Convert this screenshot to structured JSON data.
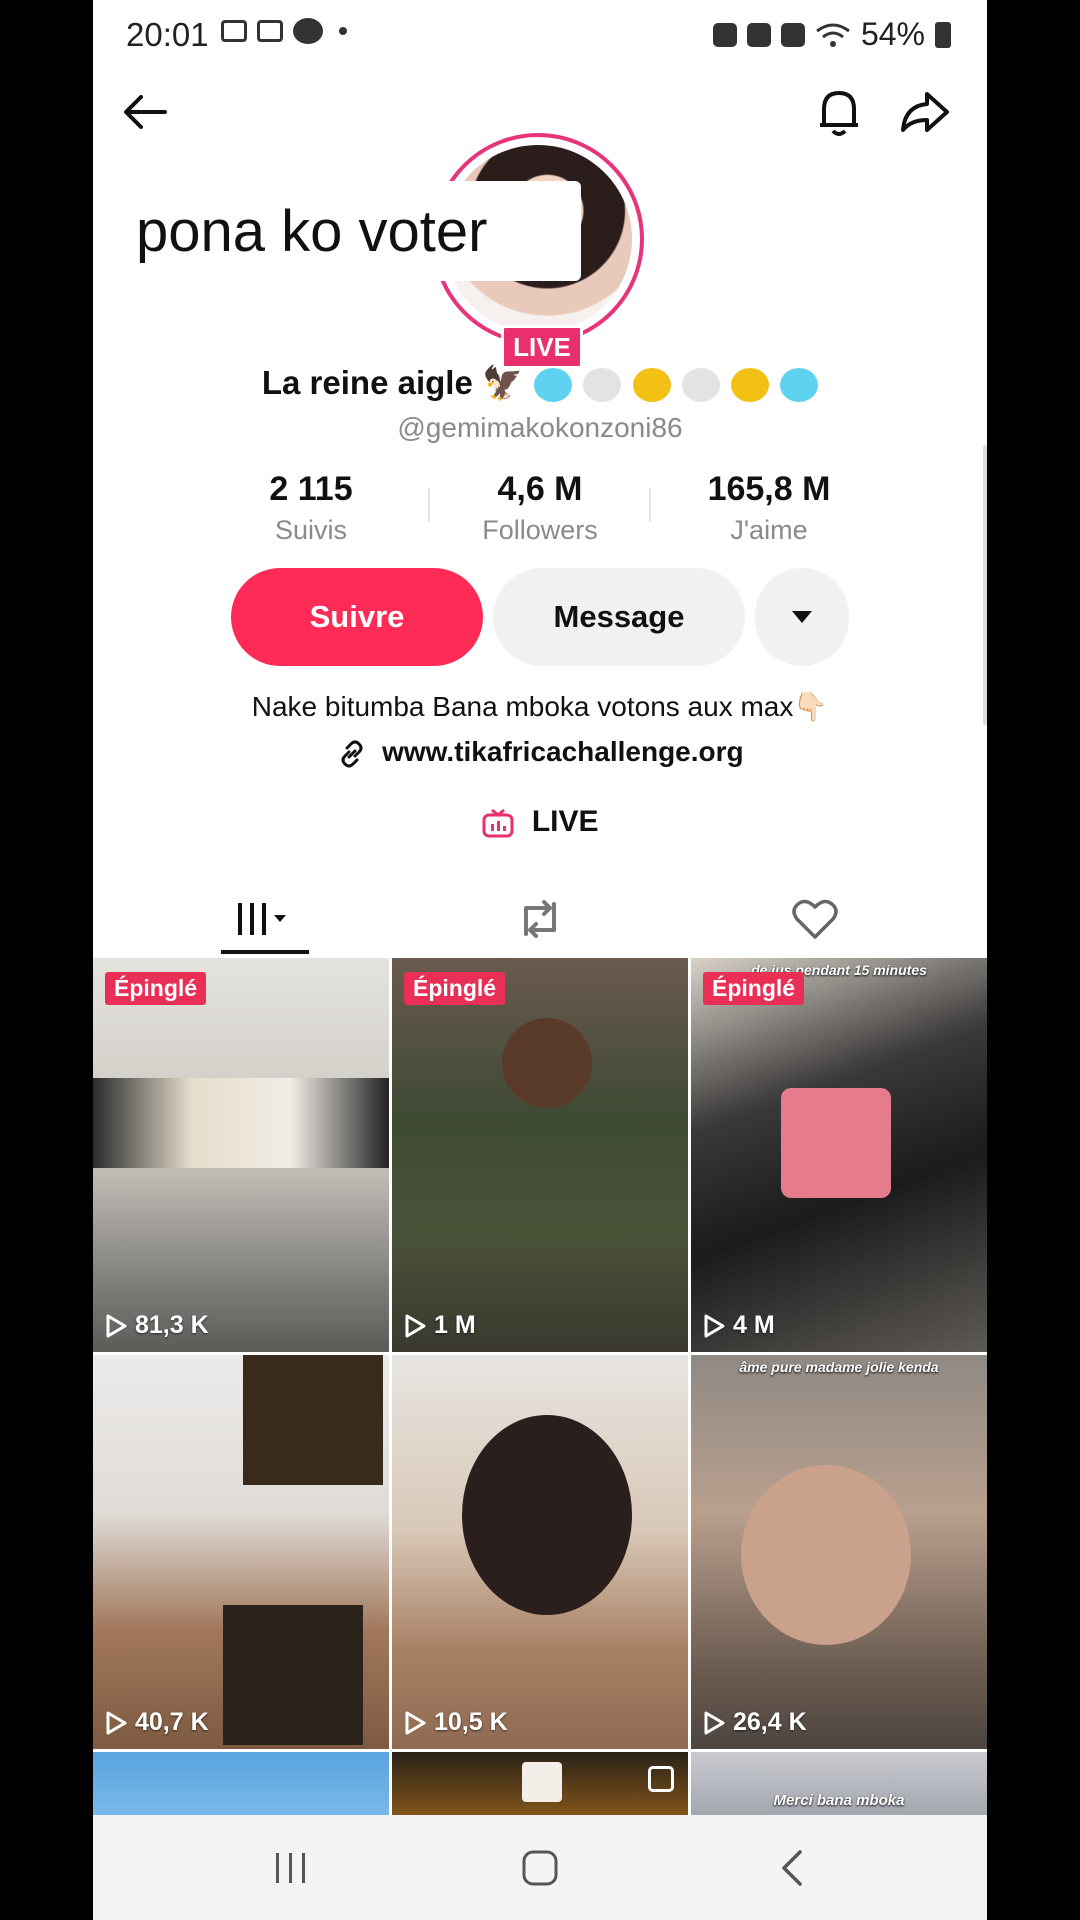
{
  "status_bar": {
    "time": "20:01",
    "battery": "54%"
  },
  "overlay_caption": "pona ko voter",
  "profile": {
    "live_badge": "LIVE",
    "name": "La reine aigle",
    "name_emoji": "🦅",
    "handle": "@gemimakokonzoni86",
    "stats": [
      {
        "value": "2 115",
        "label": "Suivis"
      },
      {
        "value": "4,6 M",
        "label": "Followers"
      },
      {
        "value": "165,8 M",
        "label": "J'aime"
      }
    ],
    "follow_label": "Suivre",
    "message_label": "Message",
    "bio": "Nake bitumba Bana mboka votons aux max👇🏻",
    "link": "www.tikafricachallenge.org",
    "live_label": "LIVE"
  },
  "tiles": [
    {
      "pinned": "Épinglé",
      "views": "81,3 K",
      "note": ""
    },
    {
      "pinned": "Épinglé",
      "views": "1 M",
      "note": ""
    },
    {
      "pinned": "Épinglé",
      "views": "4 M",
      "note": "de jus pendant 15 minutes"
    },
    {
      "pinned": "",
      "views": "40,7 K",
      "note": ""
    },
    {
      "pinned": "",
      "views": "10,5 K",
      "note": ""
    },
    {
      "pinned": "",
      "views": "26,4 K",
      "note": "âme pure madame jolie kenda"
    },
    {
      "pinned": "",
      "views": "",
      "note": ""
    },
    {
      "pinned": "",
      "views": "",
      "note": ""
    },
    {
      "pinned": "",
      "views": "",
      "note": "Merci bana mboka"
    }
  ],
  "colors": {
    "accent": "#fd2b55",
    "live": "#ea2f6e",
    "avatar_ring": "#e8347a"
  },
  "icons": {
    "back": "arrow-left-icon",
    "bell": "bell-icon",
    "share": "share-icon",
    "link": "link-icon",
    "live": "live-tv-icon",
    "tab_videos": "grid-icon",
    "tab_reposts": "repost-icon",
    "tab_liked": "heart-outline-icon"
  }
}
